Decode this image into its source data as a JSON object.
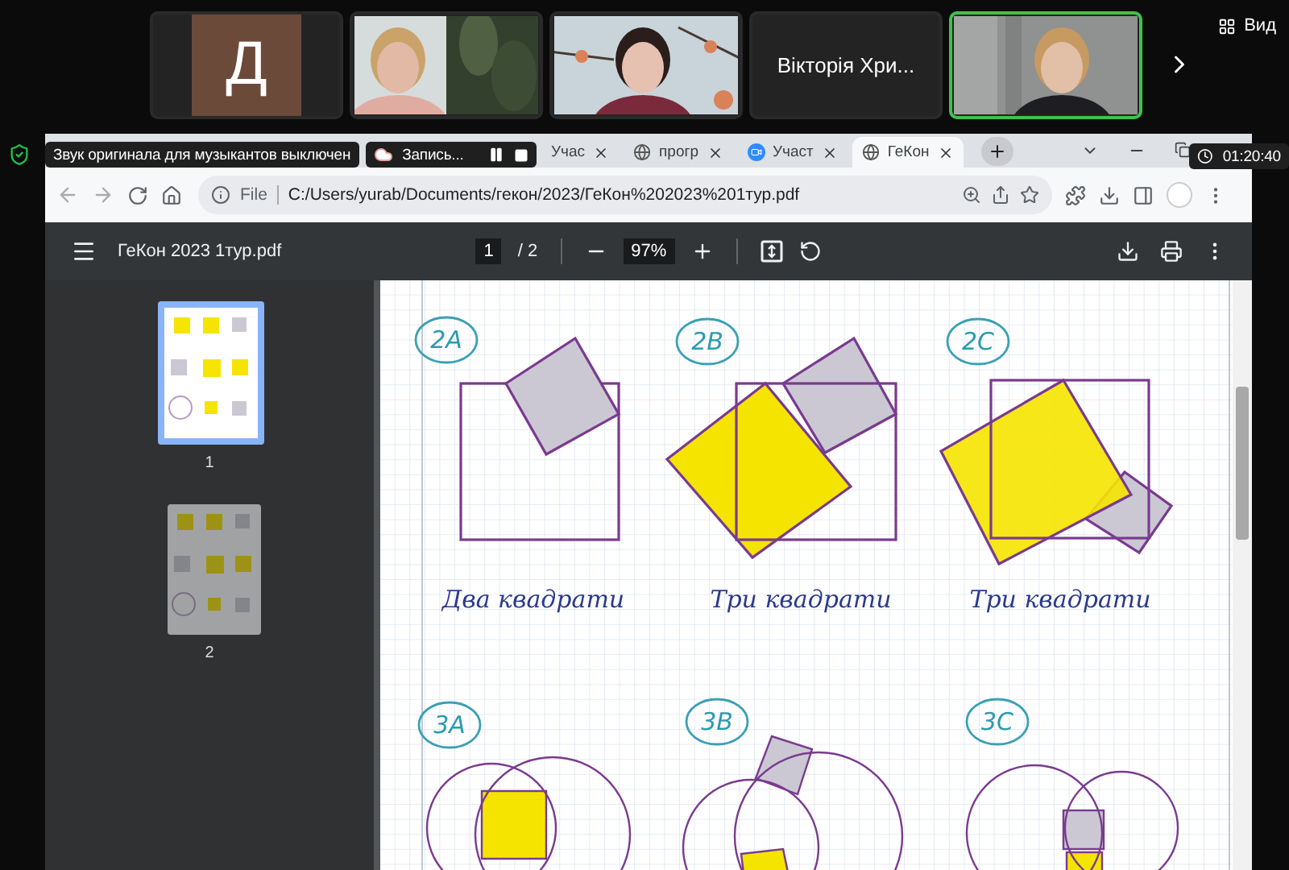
{
  "meeting": {
    "participants": [
      {
        "kind": "avatar",
        "initial": "Д",
        "speaking": false
      },
      {
        "kind": "video",
        "speaking": false
      },
      {
        "kind": "video",
        "speaking": false
      },
      {
        "kind": "name",
        "name": "Вікторія Хри...",
        "speaking": false
      },
      {
        "kind": "video",
        "speaking": true
      }
    ],
    "view_button": "Вид",
    "notification": "Звук оригинала для музыкантов выключен",
    "recording": "Запись...",
    "timer": "01:20:40"
  },
  "browser": {
    "tabs": [
      {
        "title": "Учас",
        "kind": "plain",
        "selected": false
      },
      {
        "title": "прогр",
        "kind": "web",
        "selected": false
      },
      {
        "title": "Участ",
        "kind": "meeting",
        "selected": false
      },
      {
        "title": "ГеКон",
        "kind": "web",
        "selected": true
      }
    ],
    "address": {
      "scheme": "File",
      "url": "C:/Users/yurab/Documents/гекон/2023/ГеКон%202023%201тур.pdf"
    }
  },
  "pdf_viewer": {
    "title": "ГеКон 2023 1тур.pdf",
    "page": "1",
    "page_count": "/ 2",
    "zoom": "97%",
    "thumbnails": [
      {
        "label": "1",
        "selected": true
      },
      {
        "label": "2",
        "selected": false
      }
    ]
  },
  "document": {
    "figures": [
      {
        "label": "2A",
        "caption": "Два квадрати"
      },
      {
        "label": "2B",
        "caption": "Три квадрати"
      },
      {
        "label": "2C",
        "caption": "Три квадрати"
      },
      {
        "label": "3A"
      },
      {
        "label": "3B"
      },
      {
        "label": "3C"
      }
    ]
  }
}
